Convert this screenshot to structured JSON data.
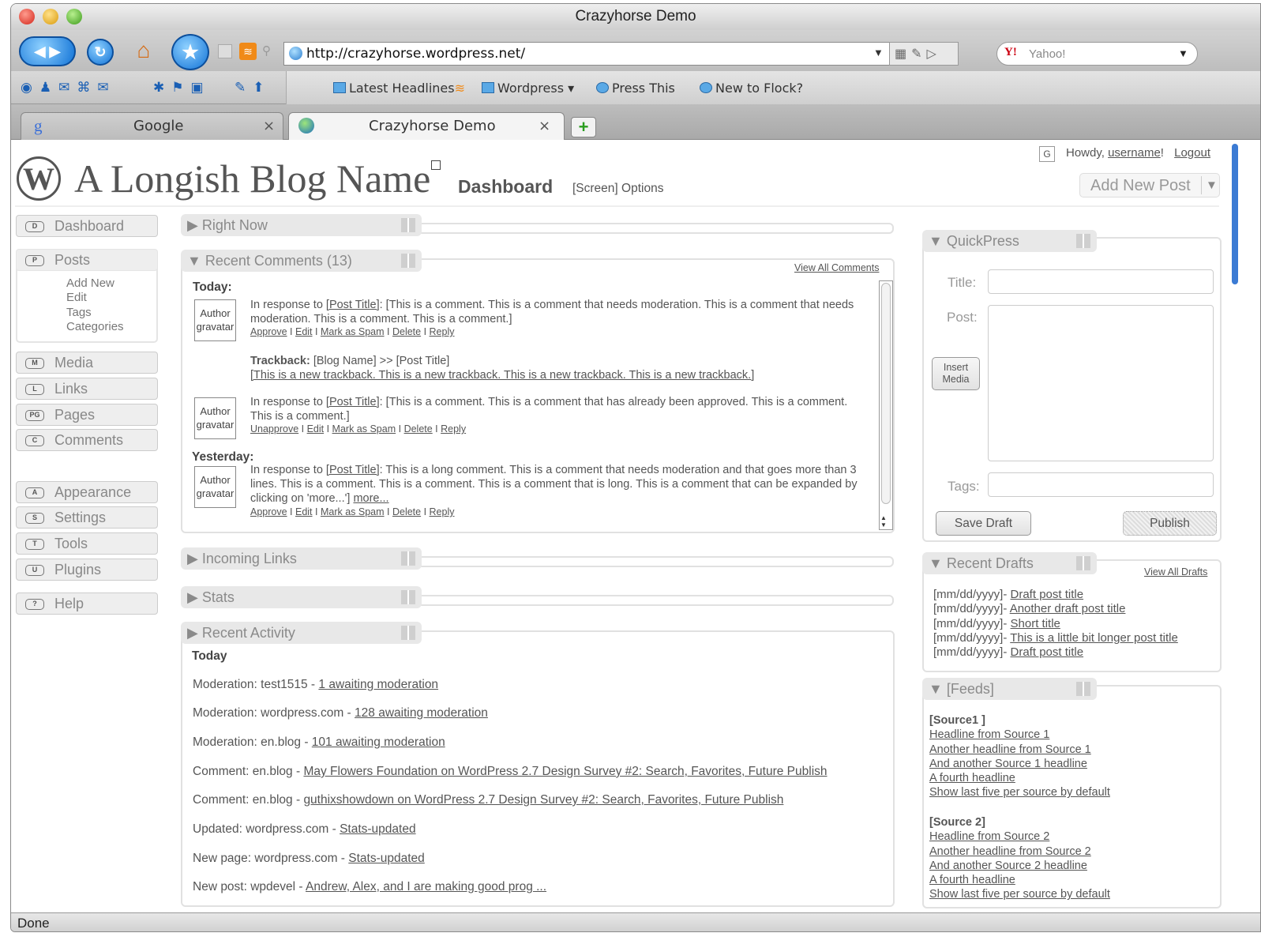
{
  "window": {
    "title": "Crazyhorse Demo",
    "status": "Done"
  },
  "nav": {
    "url": "http://crazyhorse.wordpress.net/",
    "search_engine": "Yahoo!",
    "icons": [
      "back-forward-icon",
      "refresh-icon",
      "home-icon",
      "star-icon",
      "rss-icon",
      "site-icon"
    ]
  },
  "bookmarks": [
    "Latest Headlines",
    "Wordpress",
    "Press This",
    "New to Flock?"
  ],
  "tabs": [
    {
      "label": "Google",
      "close": "×"
    },
    {
      "label": "Crazyhorse Demo",
      "close": "×"
    }
  ],
  "header": {
    "howdy_prefix": "Howdy, ",
    "username": "username",
    "howdy_suffix": "!",
    "logout": "Logout",
    "g": "G",
    "blog_name": "A Longish Blog Name",
    "page": "Dashboard",
    "screen_options": "[Screen] Options",
    "add_new": "Add New Post"
  },
  "sidebar": {
    "dashboard": {
      "key": "D",
      "label": "Dashboard"
    },
    "posts": {
      "key": "P",
      "label": "Posts",
      "sub": [
        "Add New",
        "Edit",
        "Tags",
        "Categories"
      ]
    },
    "media": {
      "key": "M",
      "label": "Media"
    },
    "links": {
      "key": "L",
      "label": "Links"
    },
    "pages": {
      "key": "PG",
      "label": "Pages"
    },
    "comments": {
      "key": "C",
      "label": "Comments"
    },
    "appearance": {
      "key": "A",
      "label": "Appearance"
    },
    "settings": {
      "key": "S",
      "label": "Settings"
    },
    "tools": {
      "key": "T",
      "label": "Tools"
    },
    "plugins": {
      "key": "U",
      "label": "Plugins"
    },
    "help": {
      "key": "?",
      "label": "Help"
    }
  },
  "right_now": {
    "title": "Right Now"
  },
  "recent_comments": {
    "title": "Recent Comments (13)",
    "view_all": "View All Comments",
    "today": "Today:",
    "yesterday": "Yesterday:",
    "gravatar": "Author gravatar",
    "c1": {
      "pre": "In response to ",
      "post": "[Post Title]",
      "text": ": [This is a comment. This is a comment that needs moderation. This is a comment that needs moderation. This is a comment. This is a comment.]",
      "actions": [
        "Approve",
        "Edit",
        "Mark as Spam",
        "Delete",
        "Reply"
      ]
    },
    "tb": {
      "label": "Trackback: ",
      "blog": "[Blog Name] >> [Post Title]",
      "text": "[This is a new trackback. This is a new trackback. This is a new trackback. This is a new trackback.]"
    },
    "c2": {
      "pre": "In response to ",
      "post": "[Post Title]",
      "text": ": [This is a comment. This is a comment that has already been approved. This is a comment. This is a comment.]",
      "actions": [
        "Unapprove",
        "Edit",
        "Mark as Spam",
        "Delete",
        "Reply"
      ]
    },
    "c3": {
      "pre": "In response to ",
      "post": "[Post Title]",
      "text": ": This is a long comment. This is a comment that needs moderation and that goes more than 3 lines. This is a comment. This is a comment. This is a comment that is long. This is a comment that can be expanded by clicking on 'more...'] ",
      "more": "more...",
      "actions": [
        "Approve",
        "Edit",
        "Mark as Spam",
        "Delete",
        "Reply"
      ]
    }
  },
  "incoming_links": {
    "title": "Incoming Links"
  },
  "stats": {
    "title": "Stats"
  },
  "recent_activity": {
    "title": "Recent Activity",
    "today": "Today",
    "items": [
      {
        "pre": "Moderation: test1515 - ",
        "link": "1 awaiting moderation"
      },
      {
        "pre": "Moderation: wordpress.com - ",
        "link": "128 awaiting moderation"
      },
      {
        "pre": "Moderation: en.blog - ",
        "link": "101 awaiting moderation"
      },
      {
        "pre": "Comment: en.blog - ",
        "link": "May Flowers Foundation on WordPress 2.7 Design Survey #2: Search, Favorites, Future Publish"
      },
      {
        "pre": "Comment: en.blog - ",
        "link": "guthixshowdown on WordPress 2.7 Design Survey #2: Search, Favorites, Future Publish"
      },
      {
        "pre": "Updated: wordpress.com - ",
        "link": "Stats-updated"
      },
      {
        "pre": "New page: wordpress.com - ",
        "link": "Stats-updated"
      },
      {
        "pre": "New post: wpdevel - ",
        "link": "Andrew, Alex, and I are making good prog ..."
      }
    ]
  },
  "quickpress": {
    "title": "QuickPress",
    "title_label": "Title:",
    "post_label": "Post:",
    "insert_media": "Insert Media",
    "tags_label": "Tags:",
    "save_draft": "Save Draft",
    "publish": "Publish"
  },
  "recent_drafts": {
    "title": "Recent Drafts",
    "view_all": "View All Drafts",
    "date": "[mm/dd/yyyy]- ",
    "items": [
      "Draft post title",
      "Another draft post title",
      "Short title",
      "This is a little bit longer post title",
      "Draft post title"
    ]
  },
  "feeds": {
    "title": "[Feeds]",
    "sources": [
      {
        "name": "[Source1 ]",
        "items": [
          "Headline from Source 1",
          "Another headline from Source 1",
          "And another Source 1 headline",
          "A fourth headline",
          "Show last five per source by default"
        ]
      },
      {
        "name": "[Source 2]",
        "items": [
          "Headline from Source 2",
          "Another headline from Source 2",
          "And another Source 2 headline",
          "A fourth headline",
          "Show last five per source by default"
        ]
      }
    ]
  }
}
